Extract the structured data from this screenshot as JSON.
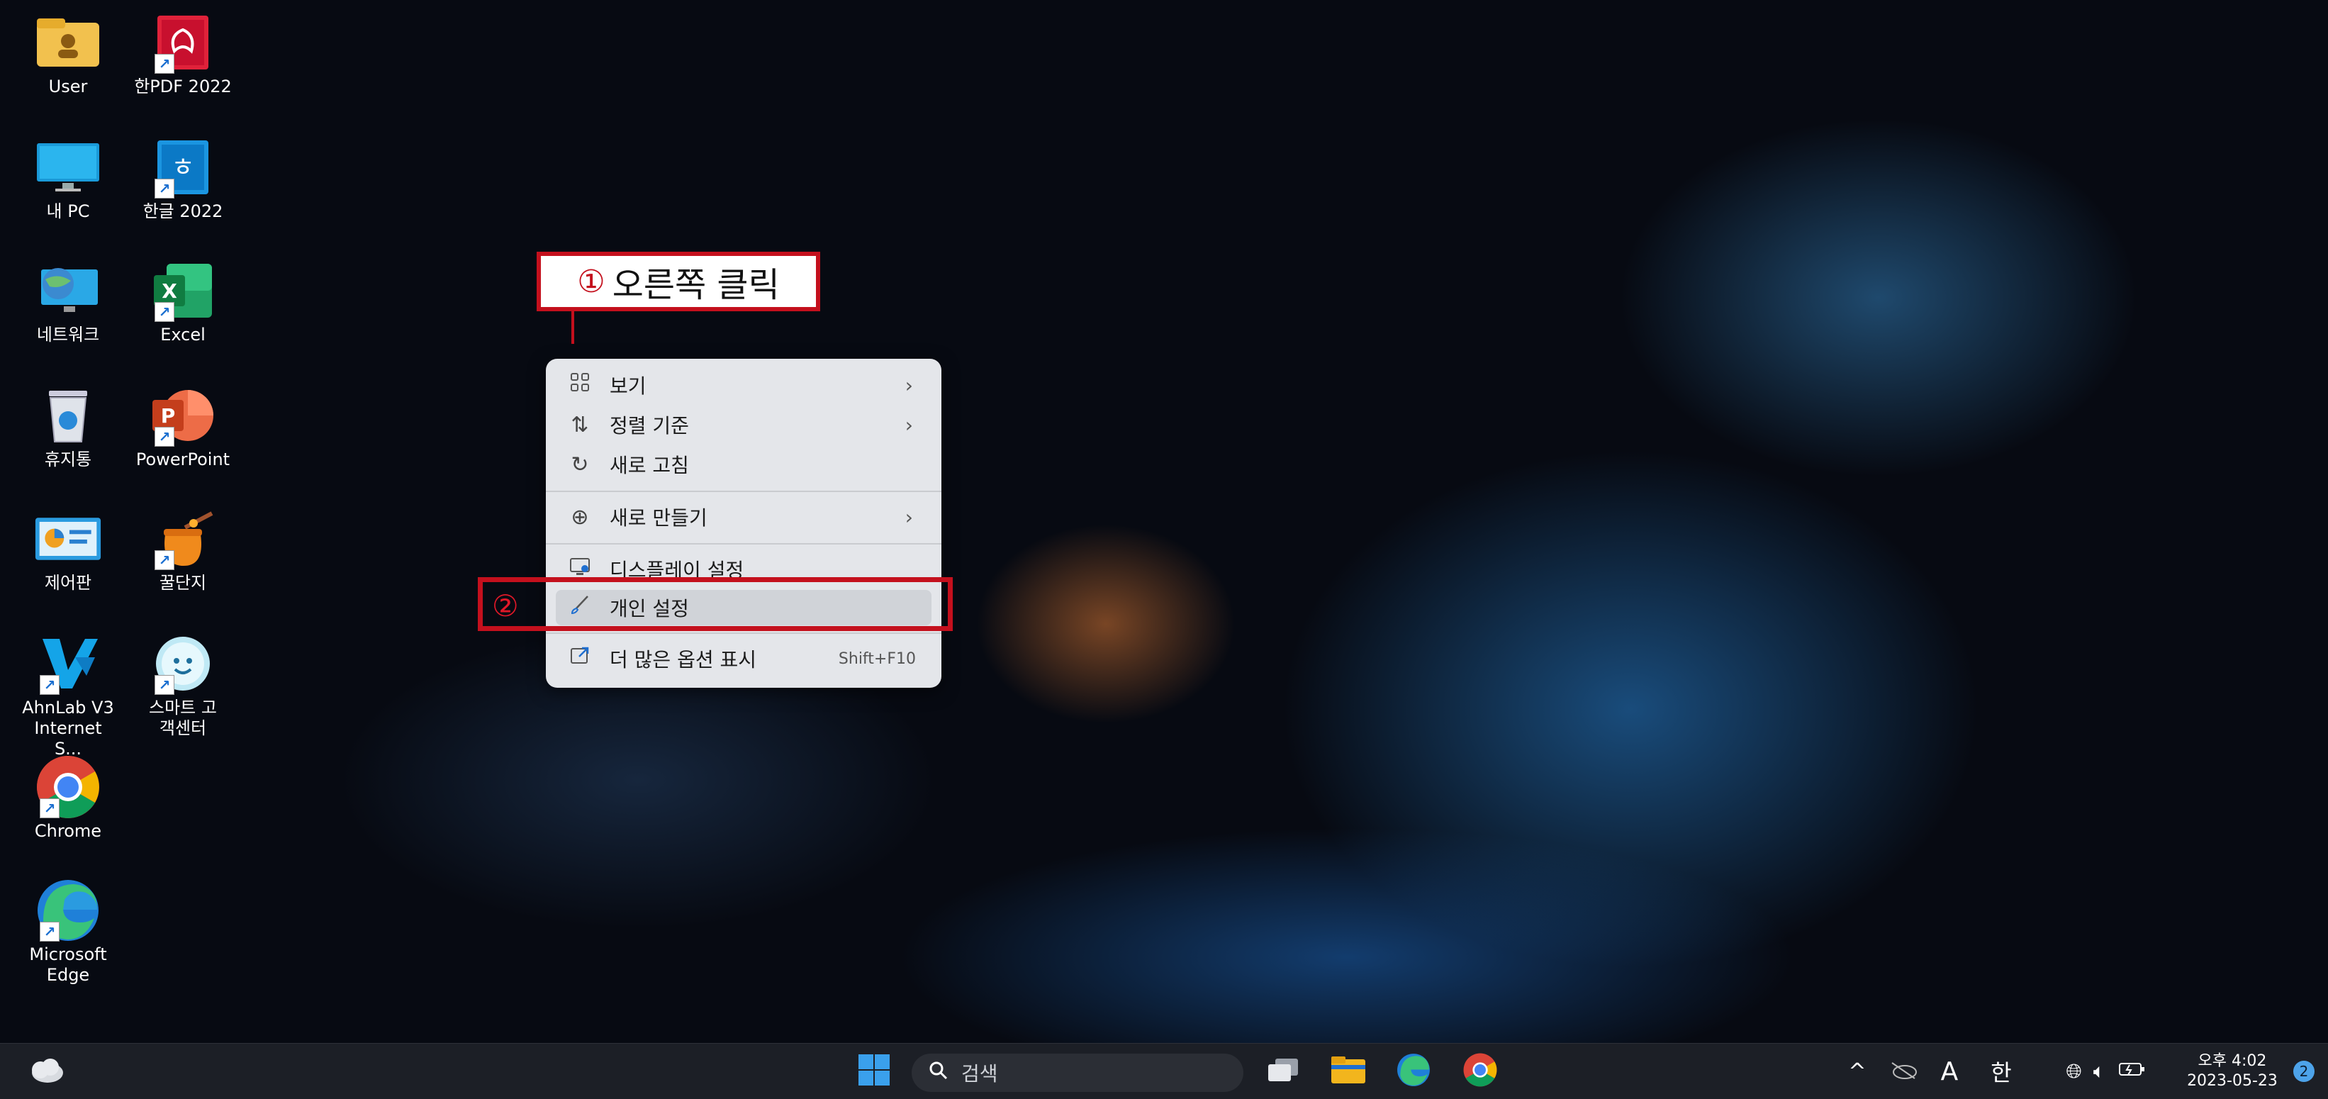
{
  "desktop_icons": [
    {
      "label": "User"
    },
    {
      "label": "한PDF 2022"
    },
    {
      "label": "내 PC"
    },
    {
      "label": "한글 2022"
    },
    {
      "label": "네트워크"
    },
    {
      "label": "Excel"
    },
    {
      "label": "휴지통"
    },
    {
      "label": "PowerPoint"
    },
    {
      "label": "제어판"
    },
    {
      "label": "꿀단지"
    },
    {
      "label": "AhnLab V3 Internet S..."
    },
    {
      "label": "스마트 고객센터"
    },
    {
      "label": "Chrome"
    },
    {
      "label": "Microsoft Edge"
    }
  ],
  "annotation1": {
    "number": "①",
    "text": "오른쪽 클릭"
  },
  "annotation2": {
    "number": "②"
  },
  "context_menu": {
    "items": [
      {
        "label": "보기",
        "icon": "grid-icon"
      },
      {
        "label": "정렬 기준",
        "icon": "sort-icon"
      },
      {
        "label": "새로 고침",
        "icon": "refresh-icon"
      },
      {
        "label": "새로 만들기",
        "icon": "plus-icon"
      },
      {
        "label": "디스플레이 설정",
        "icon": "display-icon"
      },
      {
        "label": "개인 설정",
        "icon": "brush-icon"
      },
      {
        "label": "더 많은 옵션 표시",
        "icon": "more-options-icon",
        "shortcut": "Shift+F10"
      }
    ]
  },
  "taskbar": {
    "search_placeholder": "검색",
    "tray": {
      "input_a": "A",
      "input_han": "한",
      "time": "오후 4:02",
      "date": "2023-05-23",
      "notification_count": "2"
    }
  },
  "colors": {
    "annotation_red": "#c4101d",
    "menu_bg": "#e4e6ea",
    "taskbar_bg": "#1c1f26"
  }
}
